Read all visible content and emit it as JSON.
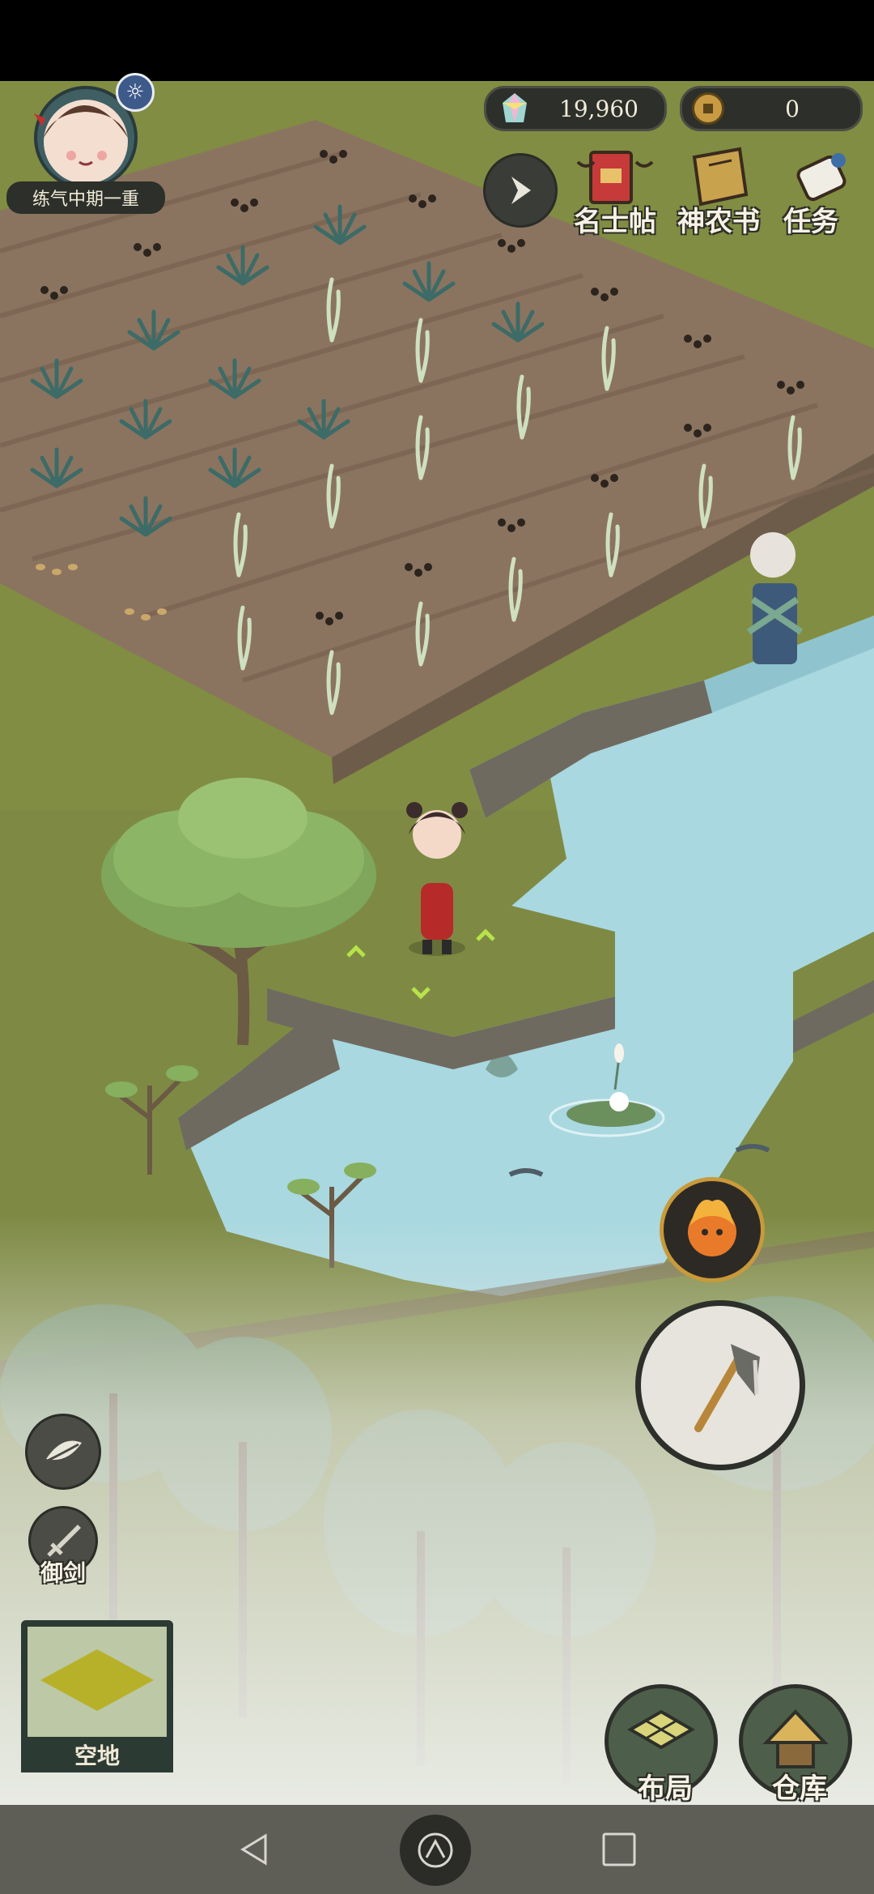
{
  "player": {
    "rank": "练气中期一重",
    "avatar_icon": "girl-portrait-icon",
    "buff_icon": "sun-icon"
  },
  "currencies": [
    {
      "name": "spirit-stone",
      "icon": "gem-icon",
      "value": "19,960"
    },
    {
      "name": "copper-coin",
      "icon": "coin-icon",
      "value": "0"
    }
  ],
  "top_menu": {
    "expand_icon": "chevron-right-icon",
    "items": [
      {
        "label": "名士帖",
        "icon": "red-invitation-icon"
      },
      {
        "label": "神农书",
        "icon": "book-icon"
      },
      {
        "label": "任务",
        "icon": "scroll-icon"
      }
    ]
  },
  "left_tools": {
    "leaf_icon": "leaf-icon",
    "sword_label": "御剑",
    "sword_icon": "sword-icon"
  },
  "tile_info": {
    "label": "空地"
  },
  "actions": {
    "skill_icon": "fire-face-icon",
    "tool_icon": "axe-icon",
    "layout_label": "布局",
    "storage_label": "仓库"
  },
  "nav": [
    "back-icon",
    "home-icon",
    "recents-icon"
  ],
  "colors": {
    "grass": "#7e8a44",
    "soil": "#8a7460",
    "water": "#a9d8e0",
    "ui_dark": "#2c2f2a",
    "label_text": "#f7f2e5"
  }
}
